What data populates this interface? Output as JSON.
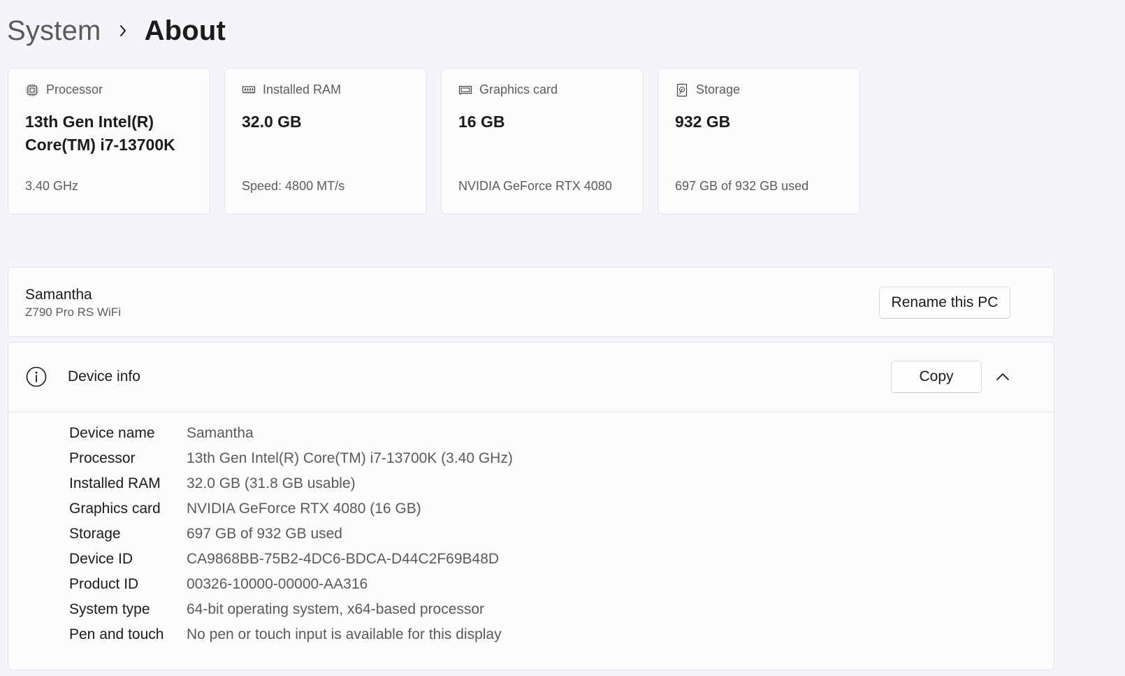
{
  "breadcrumb": {
    "parent": "System",
    "current": "About"
  },
  "cards": [
    {
      "icon": "processor-chip-icon",
      "label": "Processor",
      "value": "13th Gen Intel(R) Core(TM) i7-13700K",
      "sub": "3.40 GHz"
    },
    {
      "icon": "memory-module-icon",
      "label": "Installed RAM",
      "value": "32.0 GB",
      "sub": "Speed: 4800 MT/s"
    },
    {
      "icon": "graphics-card-icon",
      "label": "Graphics card",
      "value": "16 GB",
      "sub": "NVIDIA GeForce RTX 4080"
    },
    {
      "icon": "storage-drive-icon",
      "label": "Storage",
      "value": "932 GB",
      "sub": "697 GB of 932 GB used"
    }
  ],
  "pc": {
    "name": "Samantha",
    "model": "Z790 Pro RS WiFi",
    "rename_label": "Rename this PC"
  },
  "device_info": {
    "title": "Device info",
    "copy_label": "Copy",
    "rows": [
      {
        "label": "Device name",
        "value": "Samantha"
      },
      {
        "label": "Processor",
        "value": "13th Gen Intel(R) Core(TM) i7-13700K (3.40 GHz)"
      },
      {
        "label": "Installed RAM",
        "value": "32.0 GB (31.8 GB usable)"
      },
      {
        "label": "Graphics card",
        "value": "NVIDIA GeForce RTX 4080 (16 GB)"
      },
      {
        "label": "Storage",
        "value": "697 GB of 932 GB used"
      },
      {
        "label": "Device ID",
        "value": "CA9868BB-75B2-4DC6-BDCA-D44C2F69B48D"
      },
      {
        "label": "Product ID",
        "value": "00326-10000-00000-AA316"
      },
      {
        "label": "System type",
        "value": "64-bit operating system, x64-based processor"
      },
      {
        "label": "Pen and touch",
        "value": "No pen or touch input is available for this display"
      }
    ]
  }
}
